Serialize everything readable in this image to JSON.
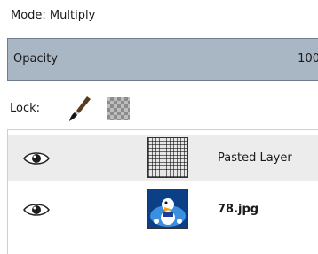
{
  "mode_label": "Mode: Multiply",
  "opacity": {
    "label": "Opacity",
    "value": "100"
  },
  "lock": {
    "label": "Lock:",
    "icons": [
      "paintbrush-icon",
      "alpha-checker-icon"
    ]
  },
  "layers": [
    {
      "name": "Pasted Layer",
      "visible": true,
      "selected": true,
      "thumbnail": "transparent-grid-thumbnail"
    },
    {
      "name": "78.jpg",
      "visible": true,
      "selected": false,
      "thumbnail": "cartoon-image-thumbnail"
    }
  ],
  "colors": {
    "opacity_bar": "#a9b6c4",
    "selected_row": "#ececec"
  }
}
